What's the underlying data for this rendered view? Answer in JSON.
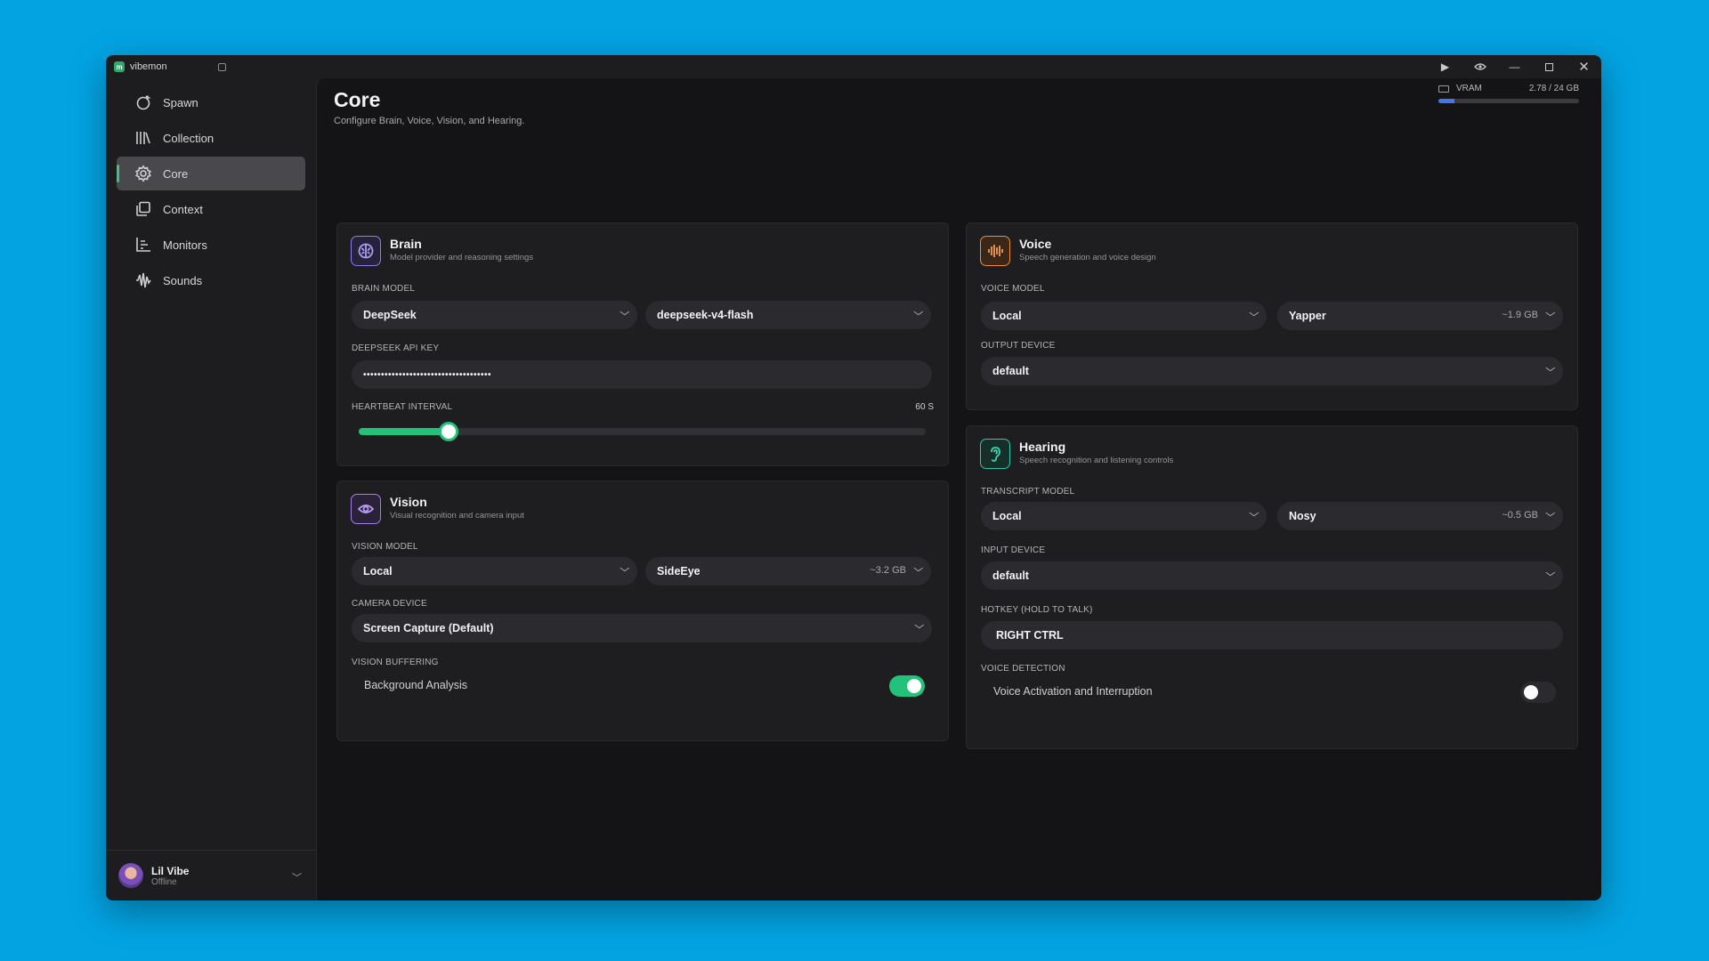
{
  "app": {
    "name": "vibemon"
  },
  "titlebar": {
    "controls": [
      "play-icon",
      "eye-icon",
      "minimize-icon",
      "maximize-icon",
      "close-icon"
    ]
  },
  "sidebar": {
    "items": [
      {
        "label": "Spawn",
        "icon": "spawn-icon"
      },
      {
        "label": "Collection",
        "icon": "library-icon"
      },
      {
        "label": "Core",
        "icon": "core-gear-icon",
        "active": true
      },
      {
        "label": "Context",
        "icon": "context-icon"
      },
      {
        "label": "Monitors",
        "icon": "chart-icon"
      },
      {
        "label": "Sounds",
        "icon": "waveform-icon"
      }
    ],
    "user": {
      "name": "Lil Vibe",
      "status": "Offline"
    }
  },
  "header": {
    "title": "Core",
    "subtitle": "Configure Brain, Voice, Vision, and Hearing.",
    "vram": {
      "label": "VRAM",
      "value": "2.78 / 24 GB",
      "fraction": 0.116
    }
  },
  "brain": {
    "title": "Brain",
    "subtitle": "Model provider and reasoning settings",
    "model_label": "BRAIN MODEL",
    "provider": "DeepSeek",
    "model": "deepseek-v4-flash",
    "api_key_label": "DEEPSEEK API KEY",
    "api_key_value": "••••••••••••••••••••••••••••••••••••",
    "heartbeat_label": "HEARTBEAT INTERVAL",
    "heartbeat_value": "60 S",
    "heartbeat_fraction": 0.158,
    "accent": "#8b7cf0"
  },
  "vision": {
    "title": "Vision",
    "subtitle": "Visual recognition and camera input",
    "model_label": "VISION MODEL",
    "provider": "Local",
    "model": "SideEye",
    "model_size": "~3.2 GB",
    "camera_label": "CAMERA DEVICE",
    "camera": "Screen Capture (Default)",
    "buffering_label": "VISION BUFFERING",
    "buffering_option": "Background Analysis",
    "buffering_on": true,
    "accent": "#a67cf0"
  },
  "voice": {
    "title": "Voice",
    "subtitle": "Speech generation and voice design",
    "model_label": "VOICE MODEL",
    "provider": "Local",
    "model": "Yapper",
    "model_size": "~1.9 GB",
    "output_label": "OUTPUT DEVICE",
    "output": "default",
    "accent": "#f08a3c"
  },
  "hearing": {
    "title": "Hearing",
    "subtitle": "Speech recognition and listening controls",
    "model_label": "TRANSCRIPT MODEL",
    "provider": "Local",
    "model": "Nosy",
    "model_size": "~0.5 GB",
    "input_label": "INPUT DEVICE",
    "input": "default",
    "hotkey_label": "HOTKEY (HOLD TO TALK)",
    "hotkey": "RIGHT CTRL",
    "detection_label": "VOICE DETECTION",
    "detection_option": "Voice Activation and Interruption",
    "detection_on": false,
    "accent": "#2fc7a8"
  }
}
